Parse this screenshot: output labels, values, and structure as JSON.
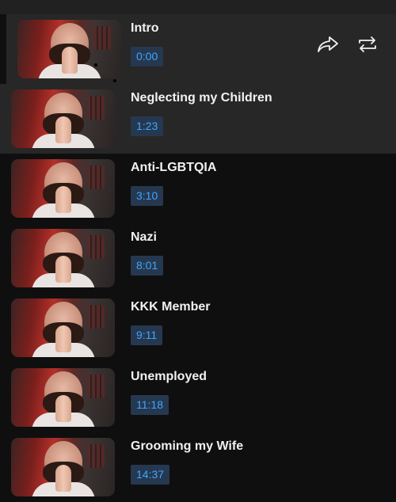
{
  "chapters": [
    {
      "title": "Intro",
      "time": "0:00"
    },
    {
      "title": "Neglecting my Children",
      "time": "1:23"
    },
    {
      "title": "Anti-LGBTQIA",
      "time": "3:10"
    },
    {
      "title": "Nazi",
      "time": "8:01"
    },
    {
      "title": "KKK Member",
      "time": "9:11"
    },
    {
      "title": "Unemployed",
      "time": "11:18"
    },
    {
      "title": "Grooming my Wife",
      "time": "14:37"
    }
  ],
  "actions": {
    "share_icon": "share-icon",
    "loop_icon": "repeat-icon"
  },
  "colors": {
    "background": "#0f0f0f",
    "highlight": "#272727",
    "timestamp_bg": "#263850",
    "timestamp_text": "#3ea6ff"
  }
}
